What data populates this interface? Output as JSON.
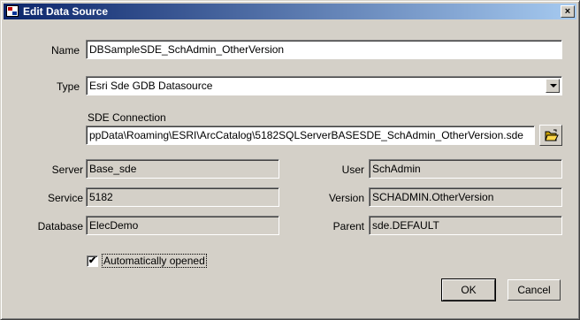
{
  "window": {
    "title": "Edit Data Source",
    "close_glyph": "×"
  },
  "form": {
    "name_label": "Name",
    "name_value": "DBSampleSDE_SchAdmin_OtherVersion",
    "type_label": "Type",
    "type_value": "Esri Sde GDB Datasource",
    "sde_connection_label": "SDE Connection",
    "sde_connection_value": "ppData\\Roaming\\ESRI\\ArcCatalog\\5182SQLServerBASESDE_SchAdmin_OtherVersion.sde",
    "server_label": "Server",
    "server_value": "Base_sde",
    "service_label": "Service",
    "service_value": "5182",
    "database_label": "Database",
    "database_value": "ElecDemo",
    "user_label": "User",
    "user_value": "SchAdmin",
    "version_label": "Version",
    "version_value": "SCHADMIN.OtherVersion",
    "parent_label": "Parent",
    "parent_value": "sde.DEFAULT",
    "auto_open_label": "Automatically opened",
    "auto_open_checked": true,
    "checkmark": "✔"
  },
  "buttons": {
    "ok": "OK",
    "cancel": "Cancel"
  }
}
